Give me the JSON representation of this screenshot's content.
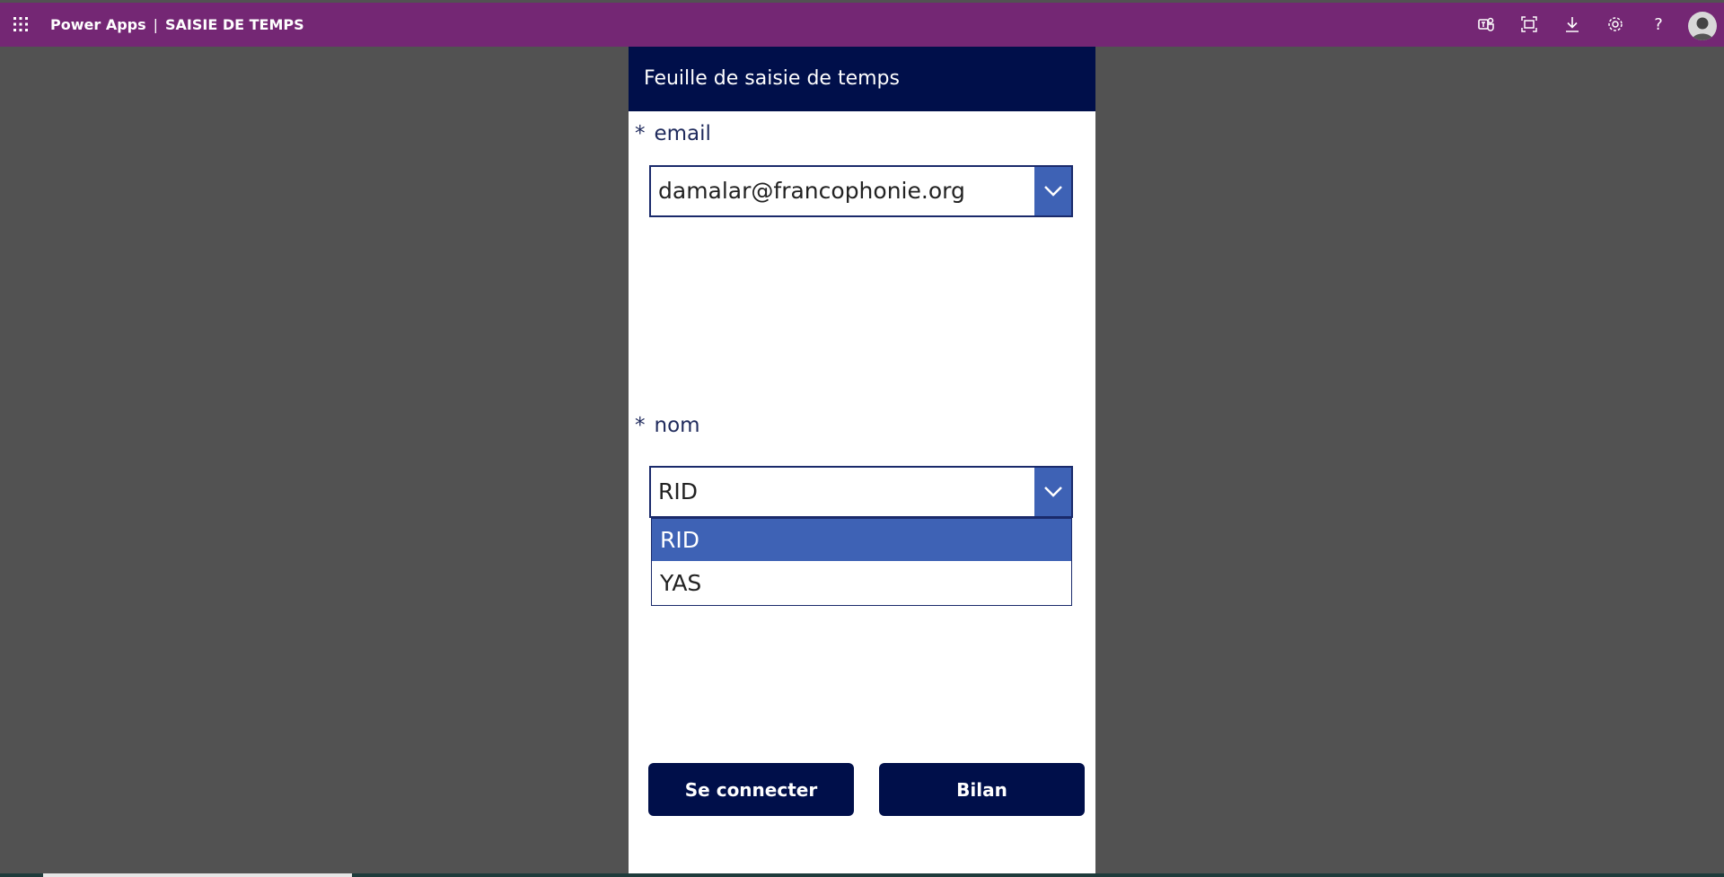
{
  "topbar": {
    "app_name": "Power Apps",
    "separator": "|",
    "app_title": "SAISIE DE TEMPS",
    "icons": [
      "waffle-icon",
      "teams-icon",
      "fit-screen-icon",
      "download-icon",
      "settings-icon",
      "help-icon",
      "avatar"
    ],
    "help_glyph": "?",
    "color": "#742774"
  },
  "form": {
    "header": "Feuille de saisie de temps",
    "header_color": "#000f4a",
    "email": {
      "required_mark": "*",
      "label": "email",
      "value": "damalar@francophonie.org"
    },
    "nom": {
      "required_mark": "*",
      "label": "nom",
      "value": "RID",
      "options": [
        "RID",
        "YAS"
      ],
      "selected_option": "RID"
    },
    "buttons": {
      "connect": "Se connecter",
      "bilan": "Bilan"
    },
    "accent_color": "#3e62b5"
  }
}
